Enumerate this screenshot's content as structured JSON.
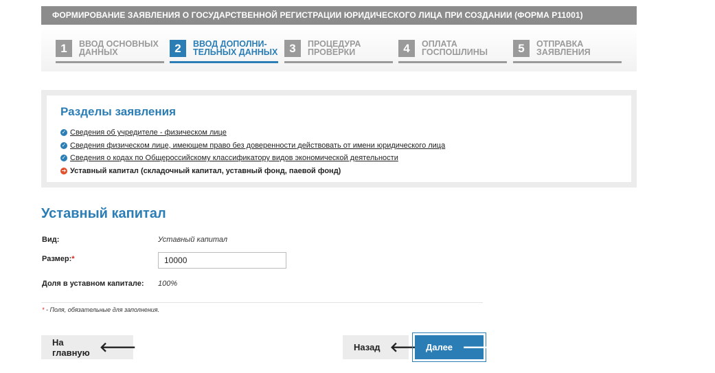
{
  "header": {
    "title": "ФОРМИРОВАНИЕ ЗАЯВЛЕНИЯ О ГОСУДАРСТВЕННОЙ РЕГИСТРАЦИИ ЮРИДИЧЕСКОГО ЛИЦА ПРИ СОЗДАНИИ (ФОРМА Р11001)"
  },
  "steps": [
    {
      "num": "1",
      "line1": "ВВОД ОСНОВНЫХ",
      "line2": "ДАННЫХ",
      "active": false
    },
    {
      "num": "2",
      "line1": "ВВОД ДОПОЛНИ-",
      "line2": "ТЕЛЬНЫХ ДАННЫХ",
      "active": true
    },
    {
      "num": "3",
      "line1": "ПРОЦЕДУРА",
      "line2": "ПРОВЕРКИ",
      "active": false
    },
    {
      "num": "4",
      "line1": "ОПЛАТА",
      "line2": "ГОСПОШЛИНЫ",
      "active": false
    },
    {
      "num": "5",
      "line1": "ОТПРАВКА",
      "line2": "ЗАЯВЛЕНИЯ",
      "active": false
    }
  ],
  "sections": {
    "title": "Разделы заявления",
    "items": [
      {
        "label": "Сведения об учредителе - физическом лице",
        "state": "done"
      },
      {
        "label": "Сведения физическом лице, имеющем право без доверенности действовать от имени юридического лица",
        "state": "done"
      },
      {
        "label": "Сведения о кодах по Общероссийскому классификатору видов экономической деятельности",
        "state": "done"
      },
      {
        "label": "Уставный капитал (складочный капитал, уставный фонд, паевой фонд)",
        "state": "current"
      }
    ]
  },
  "form": {
    "title": "Уставный капитал",
    "type_label": "Вид:",
    "type_value": "Уставный капитал",
    "size_label": "Размер:",
    "size_required_mark": "*",
    "size_value": "10000",
    "share_label": "Доля в уставном капитале:",
    "share_value": "100%",
    "note_star": "*",
    "note_text": " - Поля, обязательные для заполнения."
  },
  "buttons": {
    "home": "На главную",
    "back": "Назад",
    "next": "Далее"
  },
  "colors": {
    "accent": "#2a7db5",
    "inactive": "#9a9a9a",
    "header_bg": "#8c8c8c",
    "current_marker": "#e0502a",
    "required": "#d9261c"
  }
}
